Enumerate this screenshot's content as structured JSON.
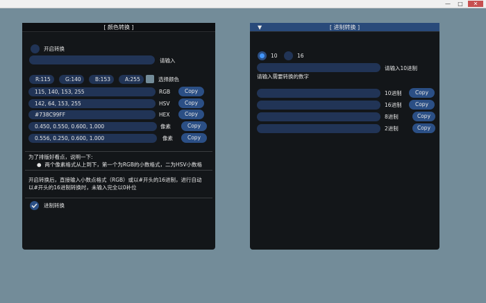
{
  "window": {
    "min": "—",
    "max": "□",
    "close": "✕"
  },
  "color_panel": {
    "title": "[ 颜色转换 ]",
    "toggle_label": "开启转换",
    "input_label": "请输入",
    "channels": [
      "R:115",
      "G:140",
      "B:153",
      "A:255"
    ],
    "pick_label": "选择颜色",
    "swatch_color": "#738C99",
    "rows": [
      {
        "value": "115, 140, 153, 255",
        "label": "RGB",
        "button": "Copy"
      },
      {
        "value": "142, 64, 153, 255",
        "label": "HSV",
        "button": "Copy"
      },
      {
        "value": "#738C99FF",
        "label": "HEX",
        "button": "Copy"
      },
      {
        "value": "0.450, 0.550, 0.600, 1.000",
        "label": "像素",
        "button": "Copy"
      },
      {
        "value": "0.556, 0.250, 0.600, 1.000",
        "label": "像素",
        "button": "Copy"
      }
    ],
    "note_title": "为了排版好看点，说明一下:",
    "note_bullet": "两个像素格式从上到下，第一个为RGB的小数格式，二为HSV小数格",
    "help_line1": "开启转换后，直接输入小数点格式（RGB）或以#开头的16进制，进行自动",
    "help_line2": "以#开头的16进制转换时，未输入完全以0补位",
    "base_toggle_label": "进制转换"
  },
  "base_panel": {
    "arrow": "▼",
    "title": "[ 进制转换 ]",
    "radio_10": "10",
    "radio_16": "16",
    "input_label": "请输入10进制",
    "prompt": "请输入需要转换的数字",
    "rows": [
      {
        "label": "10进制",
        "button": "Copy"
      },
      {
        "label": "16进制",
        "button": "Copy"
      },
      {
        "label": "8进制",
        "button": "Copy"
      },
      {
        "label": "2进制",
        "button": "Copy"
      }
    ]
  }
}
